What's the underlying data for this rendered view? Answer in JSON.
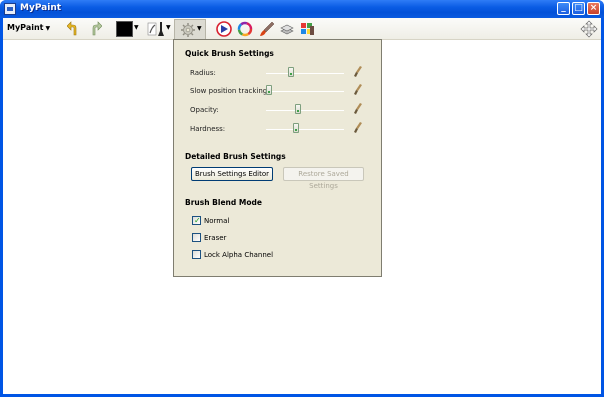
{
  "window": {
    "title": "MyPaint"
  },
  "toolbar": {
    "menu_label": "MyPaint",
    "icons": [
      "undo-icon",
      "redo-icon",
      "color-swatch",
      "brush-icon",
      "brush-settings-icon",
      "color-triangle-icon",
      "color-wheel-icon",
      "paintbrush-icon",
      "layers-icon",
      "palette-icon",
      "move-icon"
    ],
    "current_color": "#000000"
  },
  "panel": {
    "quick_title": "Quick Brush Settings",
    "sliders": [
      {
        "label": "Radius:",
        "value": 0.25
      },
      {
        "label": "Slow position tracking:",
        "value": 0.0
      },
      {
        "label": "Opacity:",
        "value": 0.4
      },
      {
        "label": "Hardness:",
        "value": 0.38
      }
    ],
    "detailed_title": "Detailed Brush Settings",
    "editor_button": "Brush Settings Editor",
    "restore_button": "Restore Saved Settings",
    "blend_title": "Brush Blend Mode",
    "blend_options": [
      {
        "label": "Normal",
        "checked": true
      },
      {
        "label": "Eraser",
        "checked": false
      },
      {
        "label": "Lock Alpha Channel",
        "checked": false
      }
    ]
  }
}
